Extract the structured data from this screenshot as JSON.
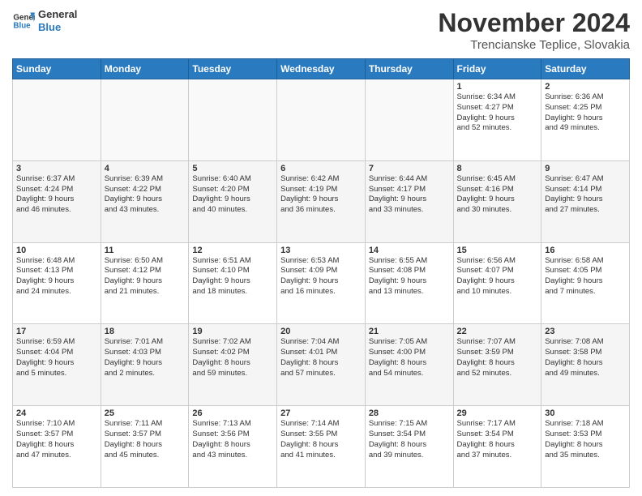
{
  "header": {
    "logo_line1": "General",
    "logo_line2": "Blue",
    "month_title": "November 2024",
    "location": "Trencianske Teplice, Slovakia"
  },
  "weekdays": [
    "Sunday",
    "Monday",
    "Tuesday",
    "Wednesday",
    "Thursday",
    "Friday",
    "Saturday"
  ],
  "weeks": [
    [
      {
        "day": "",
        "content": ""
      },
      {
        "day": "",
        "content": ""
      },
      {
        "day": "",
        "content": ""
      },
      {
        "day": "",
        "content": ""
      },
      {
        "day": "",
        "content": ""
      },
      {
        "day": "1",
        "content": "Sunrise: 6:34 AM\nSunset: 4:27 PM\nDaylight: 9 hours\nand 52 minutes."
      },
      {
        "day": "2",
        "content": "Sunrise: 6:36 AM\nSunset: 4:25 PM\nDaylight: 9 hours\nand 49 minutes."
      }
    ],
    [
      {
        "day": "3",
        "content": "Sunrise: 6:37 AM\nSunset: 4:24 PM\nDaylight: 9 hours\nand 46 minutes."
      },
      {
        "day": "4",
        "content": "Sunrise: 6:39 AM\nSunset: 4:22 PM\nDaylight: 9 hours\nand 43 minutes."
      },
      {
        "day": "5",
        "content": "Sunrise: 6:40 AM\nSunset: 4:20 PM\nDaylight: 9 hours\nand 40 minutes."
      },
      {
        "day": "6",
        "content": "Sunrise: 6:42 AM\nSunset: 4:19 PM\nDaylight: 9 hours\nand 36 minutes."
      },
      {
        "day": "7",
        "content": "Sunrise: 6:44 AM\nSunset: 4:17 PM\nDaylight: 9 hours\nand 33 minutes."
      },
      {
        "day": "8",
        "content": "Sunrise: 6:45 AM\nSunset: 4:16 PM\nDaylight: 9 hours\nand 30 minutes."
      },
      {
        "day": "9",
        "content": "Sunrise: 6:47 AM\nSunset: 4:14 PM\nDaylight: 9 hours\nand 27 minutes."
      }
    ],
    [
      {
        "day": "10",
        "content": "Sunrise: 6:48 AM\nSunset: 4:13 PM\nDaylight: 9 hours\nand 24 minutes."
      },
      {
        "day": "11",
        "content": "Sunrise: 6:50 AM\nSunset: 4:12 PM\nDaylight: 9 hours\nand 21 minutes."
      },
      {
        "day": "12",
        "content": "Sunrise: 6:51 AM\nSunset: 4:10 PM\nDaylight: 9 hours\nand 18 minutes."
      },
      {
        "day": "13",
        "content": "Sunrise: 6:53 AM\nSunset: 4:09 PM\nDaylight: 9 hours\nand 16 minutes."
      },
      {
        "day": "14",
        "content": "Sunrise: 6:55 AM\nSunset: 4:08 PM\nDaylight: 9 hours\nand 13 minutes."
      },
      {
        "day": "15",
        "content": "Sunrise: 6:56 AM\nSunset: 4:07 PM\nDaylight: 9 hours\nand 10 minutes."
      },
      {
        "day": "16",
        "content": "Sunrise: 6:58 AM\nSunset: 4:05 PM\nDaylight: 9 hours\nand 7 minutes."
      }
    ],
    [
      {
        "day": "17",
        "content": "Sunrise: 6:59 AM\nSunset: 4:04 PM\nDaylight: 9 hours\nand 5 minutes."
      },
      {
        "day": "18",
        "content": "Sunrise: 7:01 AM\nSunset: 4:03 PM\nDaylight: 9 hours\nand 2 minutes."
      },
      {
        "day": "19",
        "content": "Sunrise: 7:02 AM\nSunset: 4:02 PM\nDaylight: 8 hours\nand 59 minutes."
      },
      {
        "day": "20",
        "content": "Sunrise: 7:04 AM\nSunset: 4:01 PM\nDaylight: 8 hours\nand 57 minutes."
      },
      {
        "day": "21",
        "content": "Sunrise: 7:05 AM\nSunset: 4:00 PM\nDaylight: 8 hours\nand 54 minutes."
      },
      {
        "day": "22",
        "content": "Sunrise: 7:07 AM\nSunset: 3:59 PM\nDaylight: 8 hours\nand 52 minutes."
      },
      {
        "day": "23",
        "content": "Sunrise: 7:08 AM\nSunset: 3:58 PM\nDaylight: 8 hours\nand 49 minutes."
      }
    ],
    [
      {
        "day": "24",
        "content": "Sunrise: 7:10 AM\nSunset: 3:57 PM\nDaylight: 8 hours\nand 47 minutes."
      },
      {
        "day": "25",
        "content": "Sunrise: 7:11 AM\nSunset: 3:57 PM\nDaylight: 8 hours\nand 45 minutes."
      },
      {
        "day": "26",
        "content": "Sunrise: 7:13 AM\nSunset: 3:56 PM\nDaylight: 8 hours\nand 43 minutes."
      },
      {
        "day": "27",
        "content": "Sunrise: 7:14 AM\nSunset: 3:55 PM\nDaylight: 8 hours\nand 41 minutes."
      },
      {
        "day": "28",
        "content": "Sunrise: 7:15 AM\nSunset: 3:54 PM\nDaylight: 8 hours\nand 39 minutes."
      },
      {
        "day": "29",
        "content": "Sunrise: 7:17 AM\nSunset: 3:54 PM\nDaylight: 8 hours\nand 37 minutes."
      },
      {
        "day": "30",
        "content": "Sunrise: 7:18 AM\nSunset: 3:53 PM\nDaylight: 8 hours\nand 35 minutes."
      }
    ]
  ]
}
